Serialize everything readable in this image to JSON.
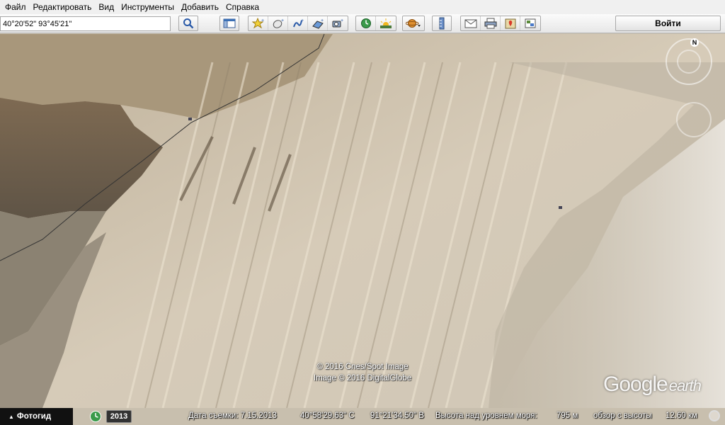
{
  "menu": {
    "items": [
      "Файл",
      "Редактировать",
      "Вид",
      "Инструменты",
      "Добавить",
      "Справка"
    ]
  },
  "toolbar": {
    "search_value": "40°20'52\" 93°45'21\"",
    "signin_label": "Войти",
    "icons": {
      "search": "magnifier-icon",
      "sidebar": "sidebar-toggle-icon",
      "placemark": "add-placemark-icon",
      "polygon": "add-polygon-icon",
      "path": "add-path-icon",
      "overlay": "image-overlay-icon",
      "tour": "record-tour-icon",
      "history": "historical-imagery-icon",
      "sun": "sunlight-icon",
      "planets": "planets-icon",
      "ruler": "ruler-icon",
      "email": "email-icon",
      "print": "print-icon",
      "maps": "view-in-maps-icon",
      "save_image": "save-image-icon"
    }
  },
  "map": {
    "copyright_lines": [
      "© 2016 Cnes/Spot Image",
      "Image © 2016 DigitalGlobe"
    ],
    "logo": {
      "google": "Google",
      "earth": "earth"
    },
    "compass_label": "N"
  },
  "statusbar": {
    "tour_guide_label": "Фотогид",
    "imagery_year": "2013",
    "imagery_date": "Дата съемки: 7.15.2013",
    "latitude": "40°58'29.63\" С",
    "longitude": "91°21'34.50\" В",
    "elevation_label": "Высота над уровнем моря:",
    "elevation_value": "795 м",
    "eye_alt_label": "обзор с высоты",
    "eye_alt_value": "12.60 км"
  }
}
